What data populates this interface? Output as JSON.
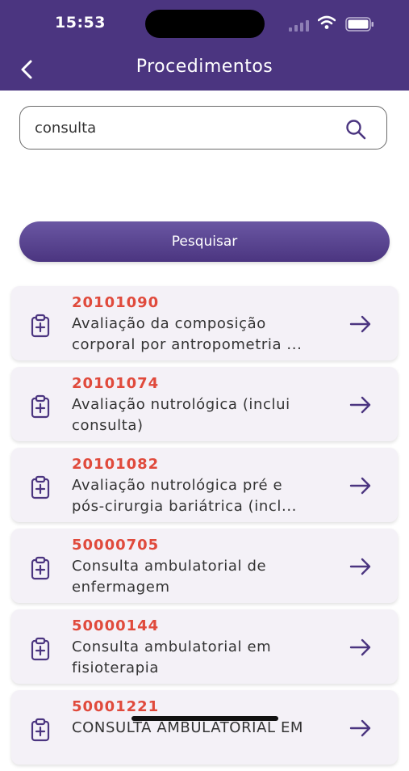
{
  "status_bar": {
    "time": "15:53"
  },
  "header": {
    "title": "Procedimentos"
  },
  "search": {
    "value": "consulta",
    "button_label": "Pesquisar"
  },
  "procedures": [
    {
      "code": "20101090",
      "description": "Avaliação da composição\ncorporal por antropometria ..."
    },
    {
      "code": "20101074",
      "description": "Avaliação nutrológica (inclui\nconsulta)"
    },
    {
      "code": "20101082",
      "description": "Avaliação nutrológica pré e\npós-cirurgia bariátrica (incl..."
    },
    {
      "code": "50000705",
      "description": "Consulta ambulatorial de\nenfermagem"
    },
    {
      "code": "50000144",
      "description": "Consulta ambulatorial em\nfisioterapia"
    },
    {
      "code": "50001221",
      "description": "CONSULTA AMBULATORIAL EM"
    }
  ],
  "icons": {
    "back": "chevron-left-icon",
    "search": "search-icon",
    "item": "clipboard-plus-icon",
    "open": "arrow-right-icon"
  },
  "colors": {
    "primary": "#4b3580",
    "code": "#e04a3c",
    "card_bg": "#f4f1f7"
  }
}
